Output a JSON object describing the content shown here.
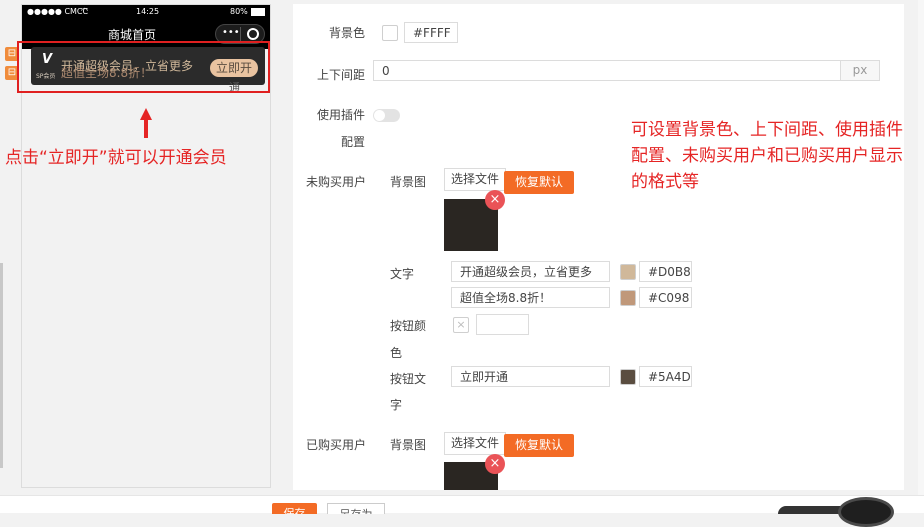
{
  "phone": {
    "carrier": "●●●●● CMCC",
    "time": "14:25",
    "battery": "80%",
    "title": "商城首页",
    "capsule_dots": "•••",
    "banner": {
      "logo_text": "V",
      "logo_sub": "SP会员",
      "line1": "开通超级会员，立省更多",
      "line2": "超值全场8.8折！",
      "button": "立即开",
      "trailing": "通"
    }
  },
  "annotations": {
    "left": "点击“立即开”就可以开通会员",
    "right": "可设置背景色、上下间距、使用插件配置、未购买用户和已购买用户显示的格式等"
  },
  "form": {
    "bg_color_label": "背景色",
    "bg_color_value": "#FFFF",
    "padding_label": "上下间距",
    "padding_value": "0",
    "padding_unit": "px",
    "plugin_label_1": "使用插件",
    "plugin_label_2": "配置",
    "unpaid": {
      "section": "未购买用户",
      "bg_label": "背景图",
      "choose_file": "选择文件",
      "restore": "恢复默认",
      "text_label": "文字",
      "text1": "开通超级会员，立省更多",
      "color1": "#D0B8",
      "text2": "超值全场8.8折！",
      "color2": "#C098",
      "btn_color_label_1": "按钮颜",
      "btn_color_label_2": "色",
      "btn_text_label_1": "按钮文",
      "btn_text_label_2": "字",
      "btn_text": "立即开通",
      "btn_text_color": "#5A4D"
    },
    "paid": {
      "section": "已购买用户",
      "bg_label": "背景图",
      "choose_file": "选择文件",
      "restore": "恢复默认"
    }
  },
  "bottom": {
    "save": "保存",
    "save_as": "另存为"
  },
  "colors": {
    "accent": "#f36b25",
    "annotation": "#e52525",
    "swatch_gold": "#d0b89a",
    "swatch_tan": "#c0987a",
    "swatch_dark": "#5a4d40"
  }
}
